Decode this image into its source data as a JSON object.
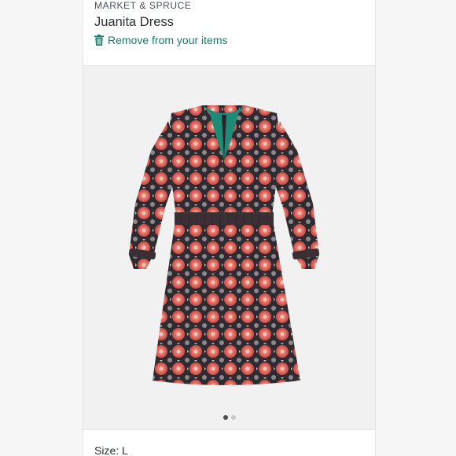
{
  "item": {
    "brand": "MARKET & SPRUCE",
    "name": "Juanita Dress",
    "remove_label": "Remove from your items",
    "size_label": "Size: L"
  },
  "carousel": {
    "total": 2,
    "active_index": 0
  },
  "icons": {
    "remove": "trash-icon"
  },
  "colors": {
    "accent": "#1c7a6e",
    "dress_lining": "#1e8a78",
    "dress_pattern_red": "#d4524f",
    "dress_pattern_dark": "#2c2a2e"
  }
}
